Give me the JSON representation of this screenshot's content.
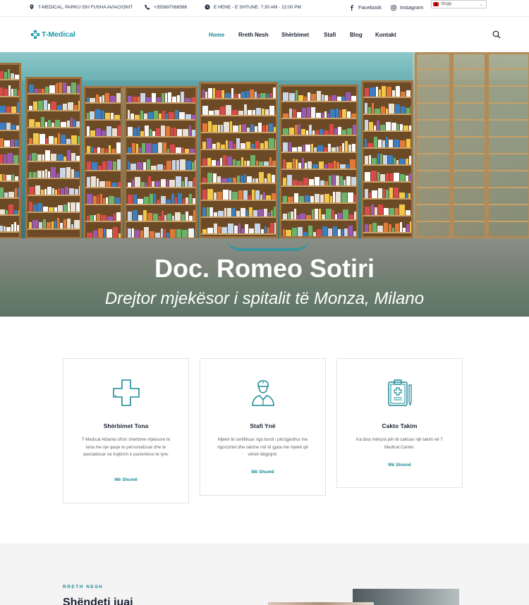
{
  "topbar": {
    "address": "T-MEDICAL, PARKU ISH FUSHA AVIACIONIT",
    "phone": "+355697066566",
    "hours": "E HENE - E SHTUNE: 7:30 AM - 22:00 PM",
    "facebook": "Facebook",
    "instagram": "Instagram",
    "language": "Shqip"
  },
  "header": {
    "logo_text": "T-Medical",
    "nav": [
      {
        "label": "Home",
        "active": true
      },
      {
        "label": "Rreth Nesh",
        "active": false
      },
      {
        "label": "Shërbimet",
        "active": false
      },
      {
        "label": "Stafi",
        "active": false
      },
      {
        "label": "Blog",
        "active": false
      },
      {
        "label": "Kontakt",
        "active": false
      }
    ]
  },
  "hero": {
    "title": "Doc. Romeo Sotiri",
    "subtitle": "Drejtor mjekësor i spitalit të Monza, Milano"
  },
  "cards": [
    {
      "icon": "medical-cross-icon",
      "title": "Shërbimet Tona",
      "text": "T-Medical Albania ofron sherbime mjeksore te larta me nje qasje te personalizuar dhe te specializuar ne trajtimin e pacienteve te tyre.",
      "link": "Më Shumë"
    },
    {
      "icon": "nurse-icon",
      "title": "Stafi Ynë",
      "text": "Mjekë të certifikuar nga bordi i përzgjedhur me rigorozitet dhe takime më të gjata me mjekë që vërtet dëgjojnë.",
      "link": "Më Shumë"
    },
    {
      "icon": "clipboard-icon",
      "title": "Cakto Takim",
      "text": "Ka disa mënyra për të caktuar një takim në T Medical Center.",
      "link": "Më Shumë"
    }
  ],
  "about": {
    "eyebrow": "RRETH NESH",
    "heading": "Shëndeti juaj"
  },
  "colors": {
    "accent": "#1a8a96",
    "dark": "#1b2233"
  }
}
